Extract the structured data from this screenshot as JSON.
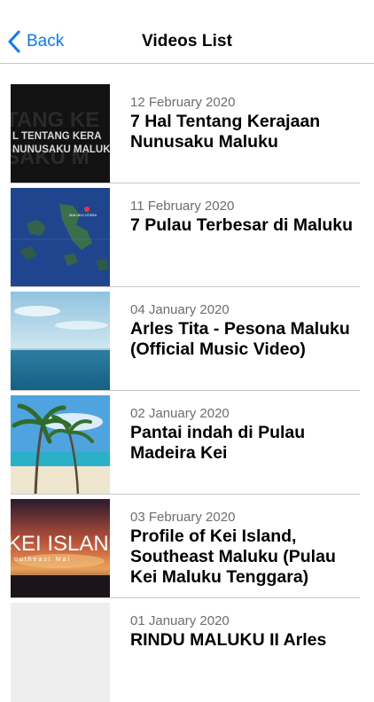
{
  "navbar": {
    "back_label": "Back",
    "title": "Videos List",
    "accent_color": "#0a7aff"
  },
  "videos": [
    {
      "date": "12 February 2020",
      "title": "7 Hal Tentang Kerajaan Nunusaku Maluku",
      "thumb_text_1": "L TENTANG KERA",
      "thumb_text_2": "NUNUSAKU MALUK"
    },
    {
      "date": "11 February 2020",
      "title": "7 Pulau Terbesar di Maluku"
    },
    {
      "date": "04 January 2020",
      "title": "Arles Tita - Pesona Maluku (Official Music Video)"
    },
    {
      "date": "02 January 2020",
      "title": "Pantai indah di Pulau Madeira Kei"
    },
    {
      "date": "03 February 2020",
      "title": "Profile of Kei Island, Southeast Maluku (Pulau Kei Maluku Tenggara)",
      "thumb_text_1": "KEI ISLAN",
      "thumb_text_2": "outheast Mal"
    },
    {
      "date": "01 January 2020",
      "title": "RINDU MALUKU II Arles"
    }
  ]
}
